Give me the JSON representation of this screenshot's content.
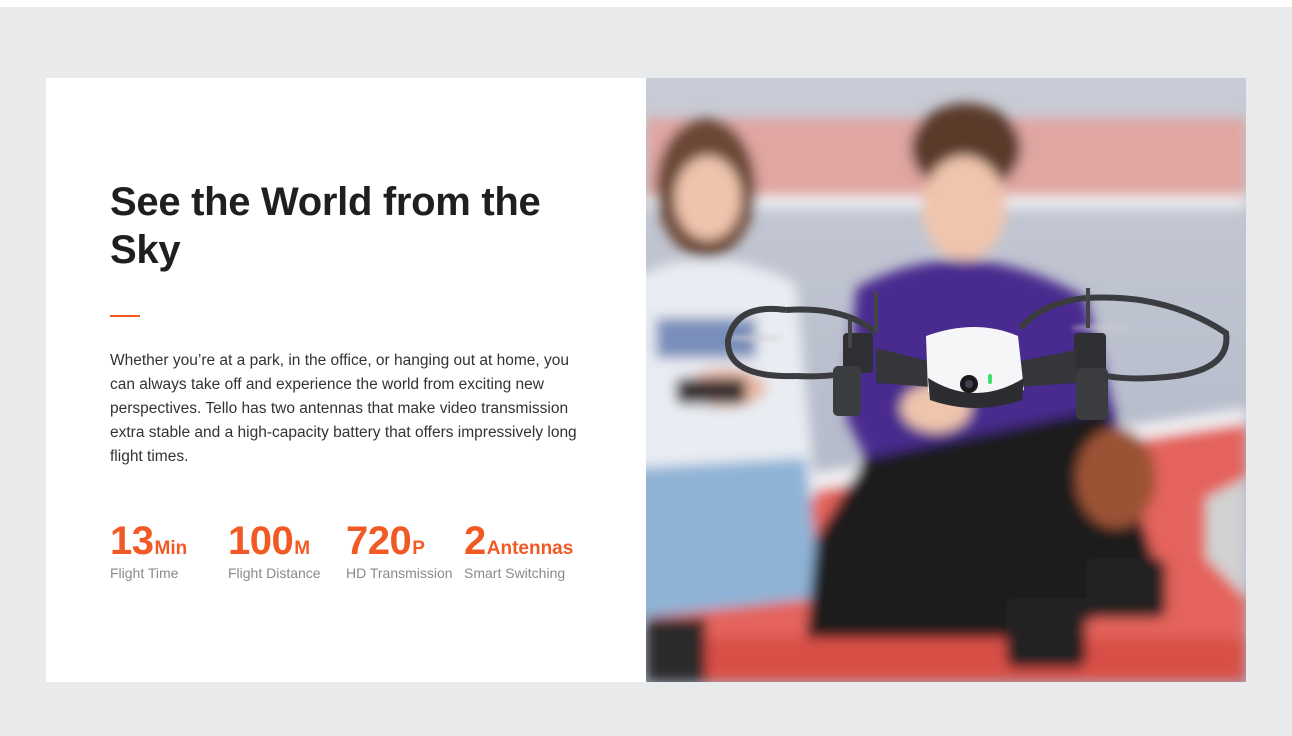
{
  "feature": {
    "title": "See the World from the Sky",
    "description": "Whether you’re at a park, in the office, or hanging out at home, you can always take off and experience the world from exciting new perspectives. Tello has two antennas that make video transmission extra stable and a high-capacity battery that offers impressively long flight times.",
    "stats": [
      {
        "value": "13",
        "unit": "Min",
        "label": "Flight Time"
      },
      {
        "value": "100",
        "unit": "M",
        "label": "Flight Distance"
      },
      {
        "value": "720",
        "unit": "P",
        "label": "HD Transmission"
      },
      {
        "value": "2",
        "unit": "Antennas",
        "label": "Smart Switching"
      }
    ]
  },
  "colors": {
    "accent": "#f15a24",
    "background": "#e9eaec",
    "title": "#1f1f1f",
    "muted": "#8a8a8a"
  },
  "photo": {
    "subject": "two kids sitting outdoors flying a small white drone"
  }
}
